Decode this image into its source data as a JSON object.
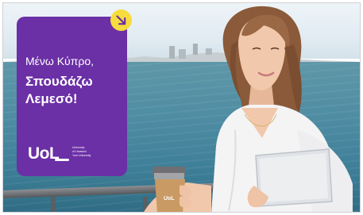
{
  "ad": {
    "headline_line1": "Μένω Κύπρο,",
    "headline_line2": "Σπουδάζω",
    "headline_line3": "Λεμεσό!",
    "logo_mark": "UoL",
    "logo_text_line1": "University",
    "logo_text_line2": "of Limassol",
    "logo_text_line3": "Your University",
    "cup_logo": "UoL",
    "arrow_icon": "arrow-down-right-icon"
  },
  "colors": {
    "card": "#6b2fa6",
    "badge": "#f6dc3c",
    "sea": "#4f8da3",
    "sky": "#eef4f8"
  }
}
